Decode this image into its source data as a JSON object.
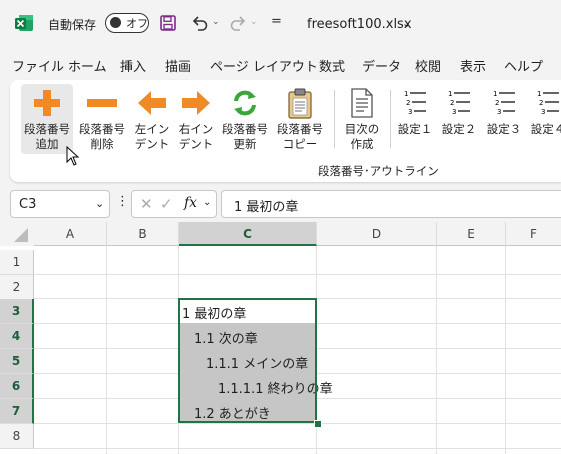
{
  "titlebar": {
    "autosave_label": "自動保存",
    "autosave_state": "オフ",
    "filename": "freesoft100.xlsx",
    "filename_chevron": "⌄",
    "qat_more": "="
  },
  "menu": [
    "ファイル",
    "ホーム",
    "挿入",
    "描画",
    "ページ レイアウト",
    "数式",
    "データ",
    "校閲",
    "表示",
    "ヘルプ"
  ],
  "ribbon": {
    "buttons": [
      {
        "line1": "段落番号",
        "line2": "追加",
        "icon": "plus-icon"
      },
      {
        "line1": "段落番号",
        "line2": "削除",
        "icon": "minus-icon"
      },
      {
        "line1": "左イン",
        "line2": "デント",
        "icon": "left-arrow-icon"
      },
      {
        "line1": "右イン",
        "line2": "デント",
        "icon": "right-arrow-icon"
      },
      {
        "line1": "段落番号",
        "line2": "更新",
        "icon": "refresh-icon"
      },
      {
        "line1": "段落番号",
        "line2": "コピー",
        "icon": "clipboard-icon"
      },
      {
        "line1": "目次の",
        "line2": "作成",
        "icon": "document-icon"
      },
      {
        "line1": "設定１",
        "icon": "numbered-list-icon"
      },
      {
        "line1": "設定２",
        "icon": "numbered-list-icon"
      },
      {
        "line1": "設定３",
        "icon": "numbered-list-icon"
      },
      {
        "line1": "設定４",
        "icon": "numbered-list-icon"
      }
    ],
    "group_label": "段落番号･アウトライン"
  },
  "formula_bar": {
    "name_box": "C3",
    "dots": "⋮",
    "cancel": "✕",
    "enter": "✓",
    "fx": "fx",
    "value": "1 最初の章"
  },
  "grid": {
    "columns": [
      "A",
      "B",
      "C",
      "D",
      "E",
      "F"
    ],
    "rows": [
      "1",
      "2",
      "3",
      "4",
      "5",
      "6",
      "7",
      "8"
    ],
    "cells": [
      {
        "ref": "C3",
        "text": "1 最初の章"
      },
      {
        "ref": "C4",
        "text": "1.1 次の章"
      },
      {
        "ref": "C5",
        "text": "1.1.1 メインの章"
      },
      {
        "ref": "C6",
        "text": "1.1.1.1 終わりの章"
      },
      {
        "ref": "C7",
        "text": "1.2 あとがき"
      }
    ],
    "selected_range": "C3:C7",
    "selection_color": "#217346",
    "shade_color": "#c6c6c6"
  },
  "colors": {
    "excel_green": "#107c41",
    "accent_orange": "#f08a24",
    "refresh_green": "#3aa53a"
  }
}
